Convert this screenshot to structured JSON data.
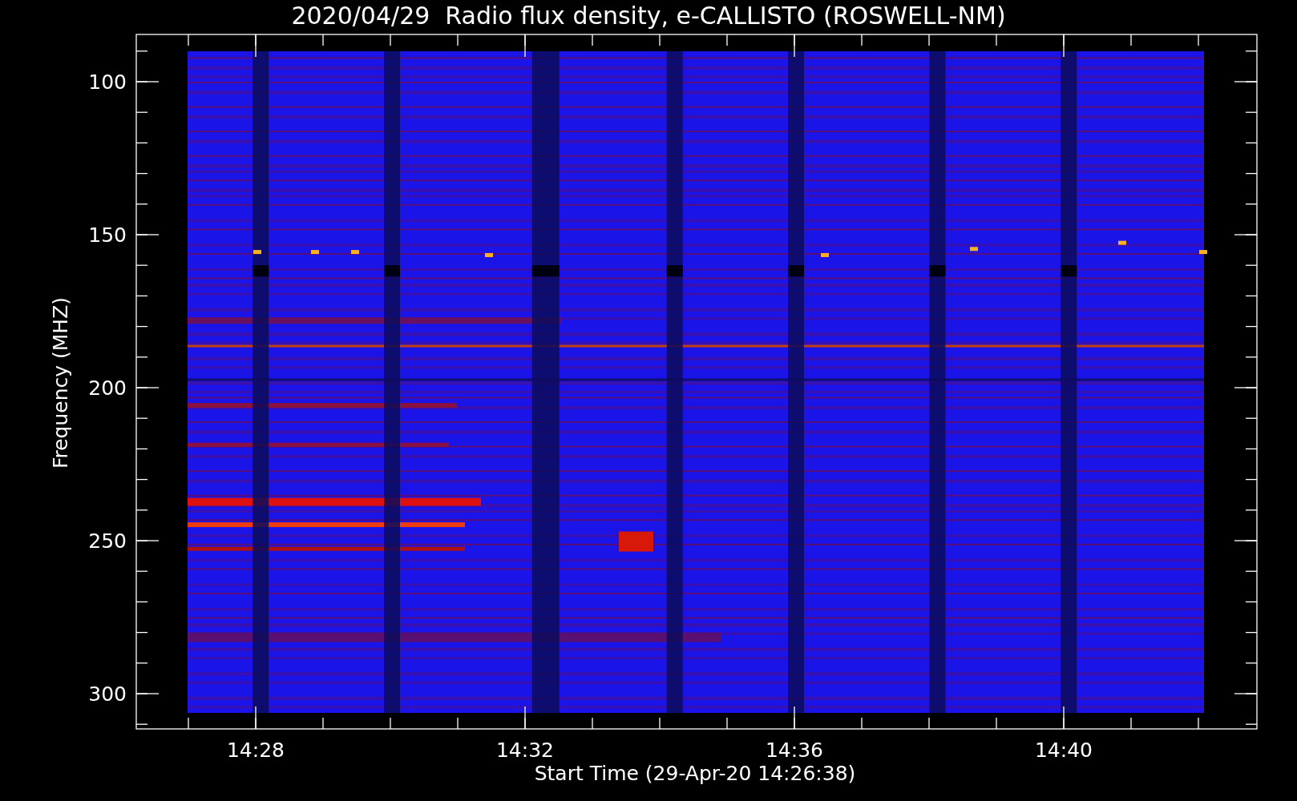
{
  "plot": {
    "title": "2020/04/29  Radio flux density, e-CALLISTO (ROSWELL-NM)",
    "ylabel": "Frequency (MHZ)",
    "xlabel": "Start Time (29-Apr-20 14:26:38)",
    "y_tick_labels": [
      "100",
      "150",
      "200",
      "250",
      "300"
    ],
    "x_tick_labels": [
      "14:28",
      "14:32",
      "14:36",
      "14:40"
    ]
  }
}
